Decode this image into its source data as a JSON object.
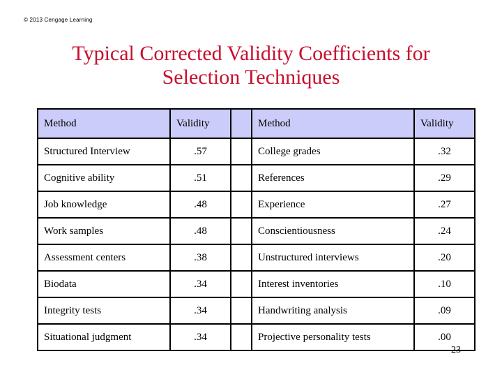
{
  "slide": {
    "copyright": "© 2013 Cengage Learning",
    "title_line_1": "Typical Corrected Validity Coefficients for",
    "title_line_2": "Selection Techniques",
    "page_number": "23",
    "title_color": "#C8102E",
    "header_bg_color": "#CCCCFA",
    "border_color": "#000000",
    "background_color": "#FFFFFF"
  },
  "table": {
    "headers": {
      "left_method": "Method",
      "left_validity": "Validity",
      "gap": "",
      "right_method": "Method",
      "right_validity": "Validity"
    },
    "rows": [
      {
        "left_method": "Structured Interview",
        "left_validity": ".57",
        "right_method": "College grades",
        "right_validity": ".32"
      },
      {
        "left_method": "Cognitive ability",
        "left_validity": ".51",
        "right_method": "References",
        "right_validity": ".29"
      },
      {
        "left_method": "Job knowledge",
        "left_validity": ".48",
        "right_method": "Experience",
        "right_validity": ".27"
      },
      {
        "left_method": "Work samples",
        "left_validity": ".48",
        "right_method": "Conscientiousness",
        "right_validity": ".24"
      },
      {
        "left_method": "Assessment centers",
        "left_validity": ".38",
        "right_method": "Unstructured interviews",
        "right_validity": ".20"
      },
      {
        "left_method": "Biodata",
        "left_validity": ".34",
        "right_method": "Interest inventories",
        "right_validity": ".10"
      },
      {
        "left_method": "Integrity tests",
        "left_validity": ".34",
        "right_method": "Handwriting analysis",
        "right_validity": ".09"
      },
      {
        "left_method": "Situational judgment",
        "left_validity": ".34",
        "right_method": "Projective personality tests",
        "right_validity": ".00"
      }
    ]
  },
  "chart_data": {
    "type": "table",
    "title": "Typical Corrected Validity Coefficients for Selection Techniques",
    "columns": [
      "Method",
      "Validity"
    ],
    "categories": [
      "Structured Interview",
      "Cognitive ability",
      "Job knowledge",
      "Work samples",
      "Assessment centers",
      "Biodata",
      "Integrity tests",
      "Situational judgment",
      "College grades",
      "References",
      "Experience",
      "Conscientiousness",
      "Unstructured interviews",
      "Interest inventories",
      "Handwriting analysis",
      "Projective personality tests"
    ],
    "values": [
      0.57,
      0.51,
      0.48,
      0.48,
      0.38,
      0.34,
      0.34,
      0.34,
      0.32,
      0.29,
      0.27,
      0.24,
      0.2,
      0.1,
      0.09,
      0.0
    ],
    "ylabel": "Validity",
    "xlabel": "Method",
    "ylim": [
      0,
      1
    ]
  }
}
